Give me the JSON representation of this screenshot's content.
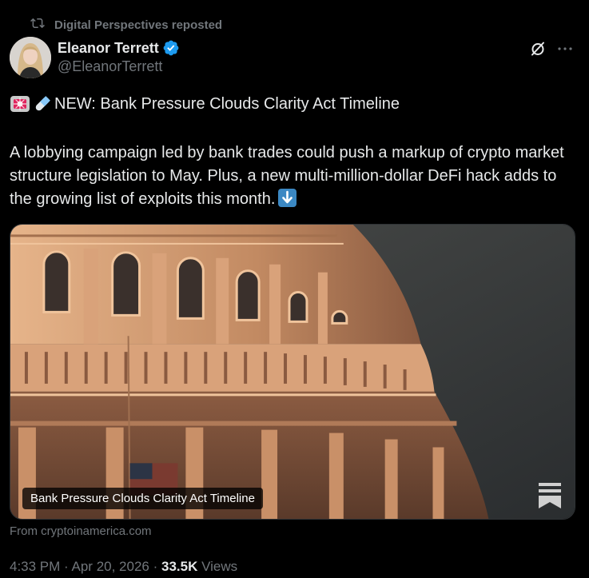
{
  "repost": {
    "label": "Digital Perspectives reposted",
    "icon": "repost-icon"
  },
  "author": {
    "name": "Eleanor Terrett",
    "handle": "@EleanorTerrett",
    "verified": true,
    "verified_color": "#1d9bf0"
  },
  "actions": {
    "grok_icon": "grok-icon",
    "more_icon": "more-icon"
  },
  "tweet": {
    "title_emojis": [
      "siren-emoji",
      "pill-emoji"
    ],
    "title": "NEW: Bank Pressure Clouds Clarity Act Timeline",
    "body": "A lobbying campaign led by bank trades could push a markup of crypto market structure legislation to May. Plus, a new multi-million-dollar DeFi hack adds to the growing list of exploits this month.",
    "body_end_emoji": "down-arrow-emoji"
  },
  "card": {
    "image": "capitol-dome-photo",
    "caption": "Bank Pressure Clouds Clarity Act Timeline",
    "logo_icon": "bookmark-logo-icon",
    "source": "From cryptoinamerica.com"
  },
  "meta": {
    "time": "4:33 PM",
    "separator": "·",
    "date": "Apr 20, 2026",
    "views_count": "33.5K",
    "views_label": "Views"
  },
  "colors": {
    "background": "#000000",
    "text": "#e7e9ea",
    "muted": "#71767b",
    "accent": "#1d9bf0"
  }
}
